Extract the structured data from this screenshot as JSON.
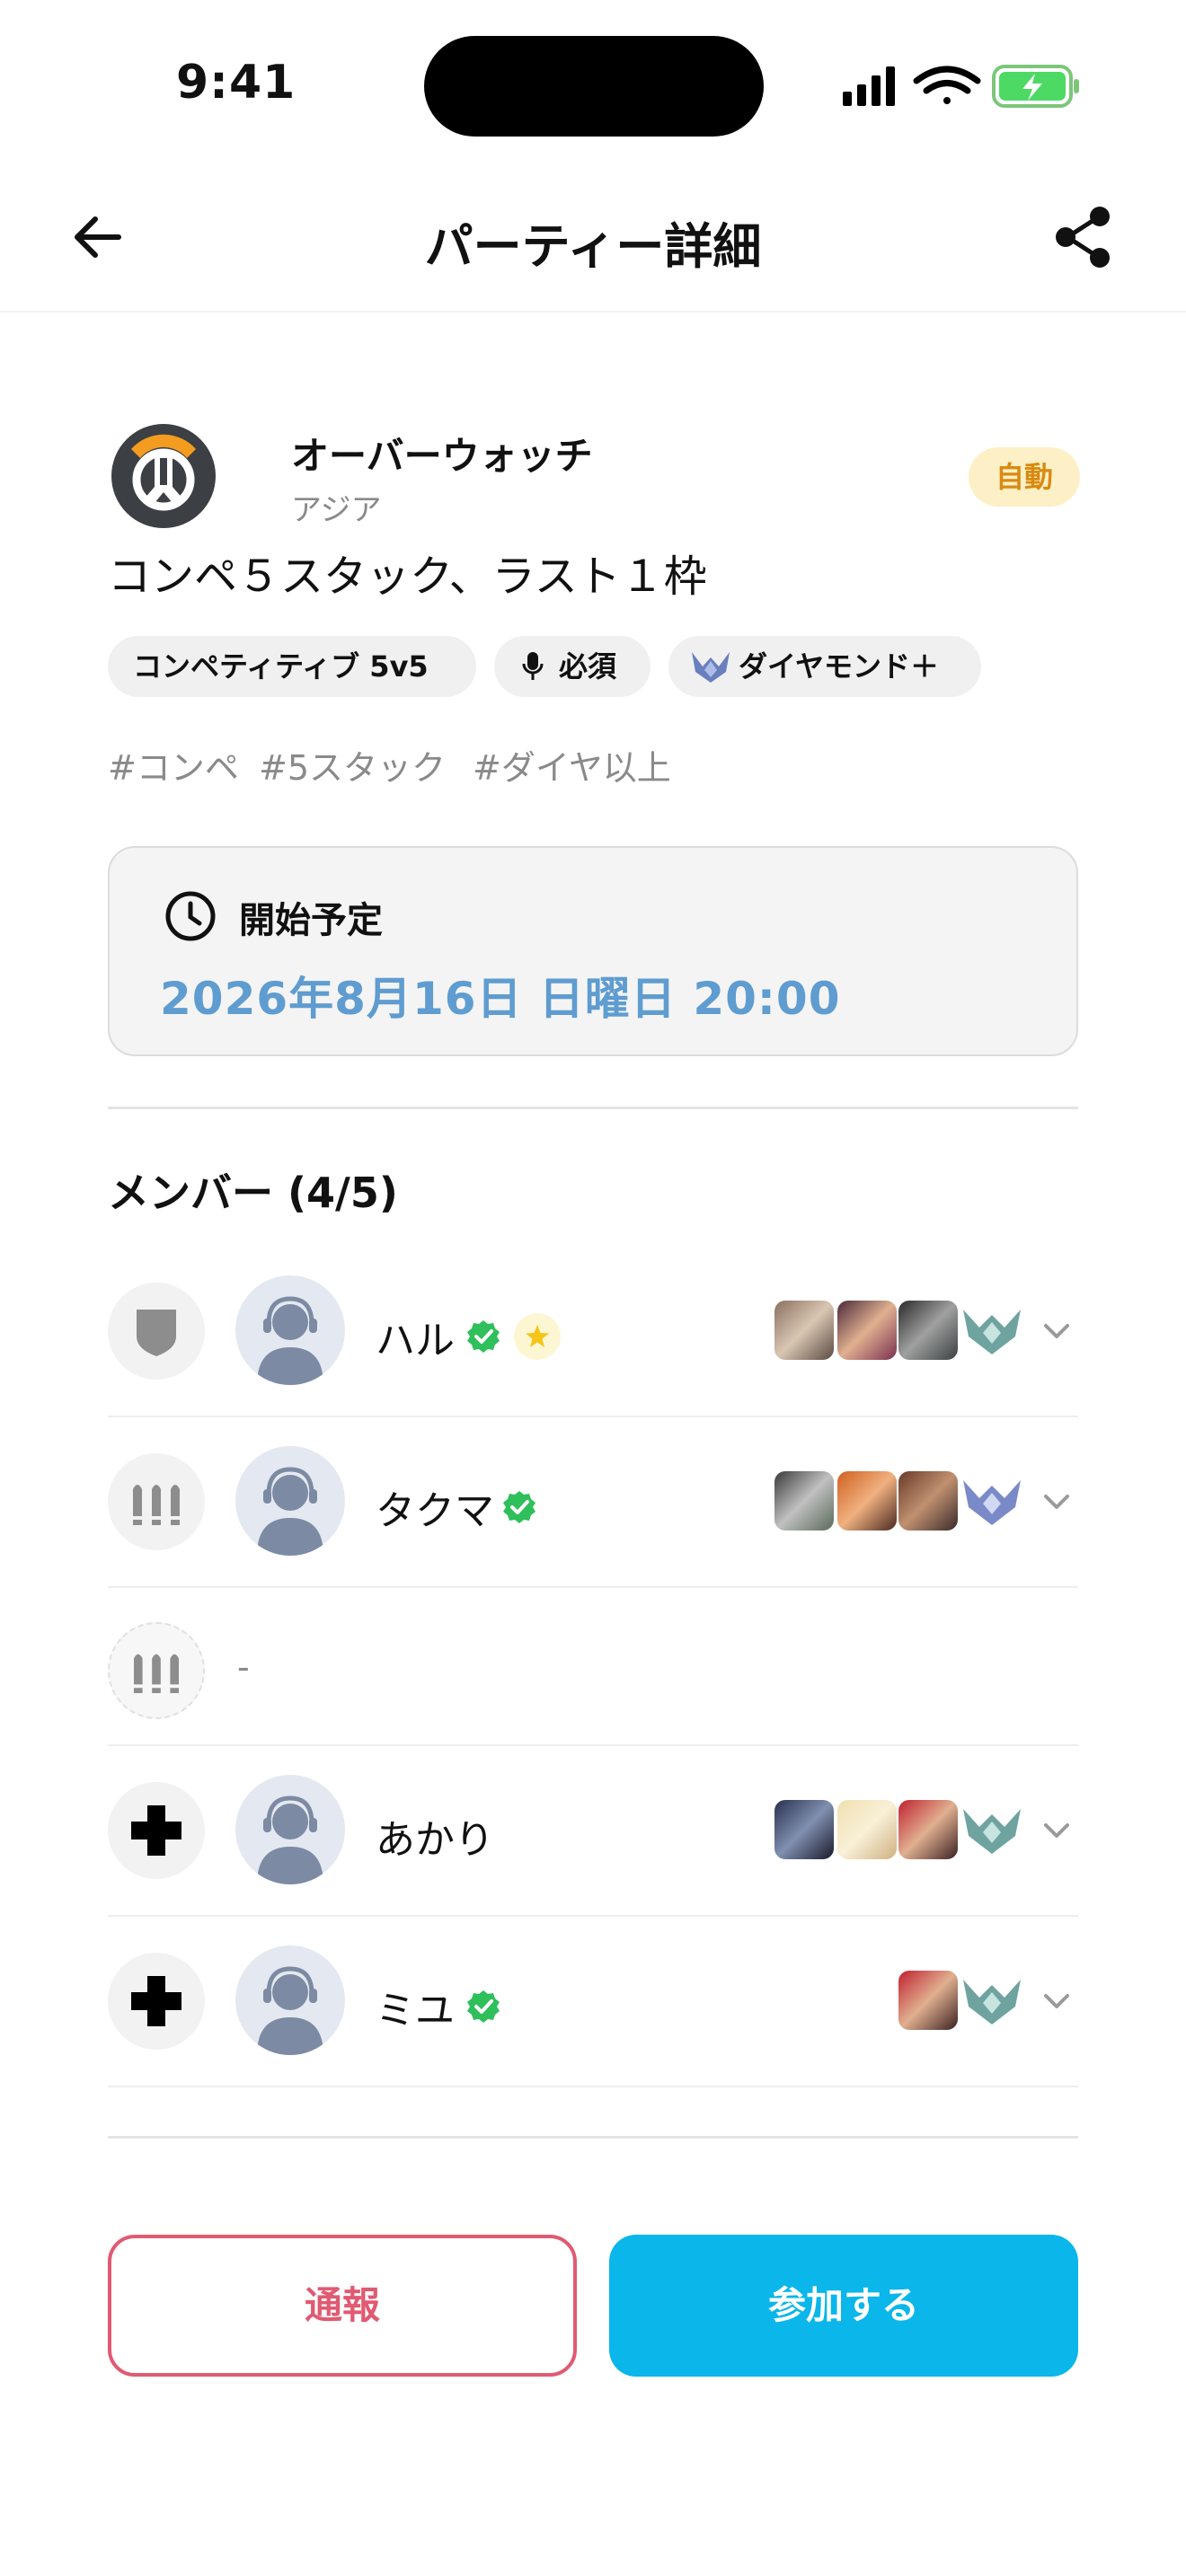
{
  "status_bar": {
    "time": "9:41"
  },
  "header": {
    "title": "パーティー詳細"
  },
  "game": {
    "name": "オーバーウォッチ",
    "region": "アジア",
    "mode_badge": "自動",
    "party_title": "コンペ５スタック、ラスト１枠"
  },
  "chips": {
    "mode": "コンペティティブ 5v5",
    "voice": "必須",
    "rank": "ダイヤモンド＋"
  },
  "tags": [
    "#コンペ",
    "#5スタック",
    "#ダイヤ以上"
  ],
  "schedule": {
    "label": "開始予定",
    "date": "2026年8月16日 日曜日 20:00"
  },
  "members": {
    "title": "メンバー (4/5)",
    "rows": [
      {
        "role": "tank",
        "name": "ハル",
        "verified": true,
        "host": true,
        "heroes": 3
      },
      {
        "role": "damage",
        "name": "タクマ",
        "verified": true,
        "host": false,
        "heroes": 3
      },
      {
        "role": "damage",
        "empty": true,
        "name": "-"
      },
      {
        "role": "support",
        "name": "あかり",
        "verified": false,
        "host": false,
        "heroes": 3
      },
      {
        "role": "support",
        "name": "ミユ",
        "verified": true,
        "host": false,
        "heroes": 1
      }
    ]
  },
  "actions": {
    "report": "通報",
    "join": "参加する"
  },
  "colors": {
    "accent": "#0ab6ea",
    "danger": "#e05a72",
    "verified": "#2fbf5b",
    "date": "#5f9cd0",
    "badge_bg": "#fdf0c6",
    "badge_text": "#d98a10"
  },
  "icons": [
    "back-arrow-icon",
    "share-icon",
    "clock-icon",
    "mic-icon",
    "rank-icon",
    "verified-icon",
    "star-icon",
    "chevron-down-icon",
    "tank-role-icon",
    "damage-role-icon",
    "support-role-icon"
  ]
}
